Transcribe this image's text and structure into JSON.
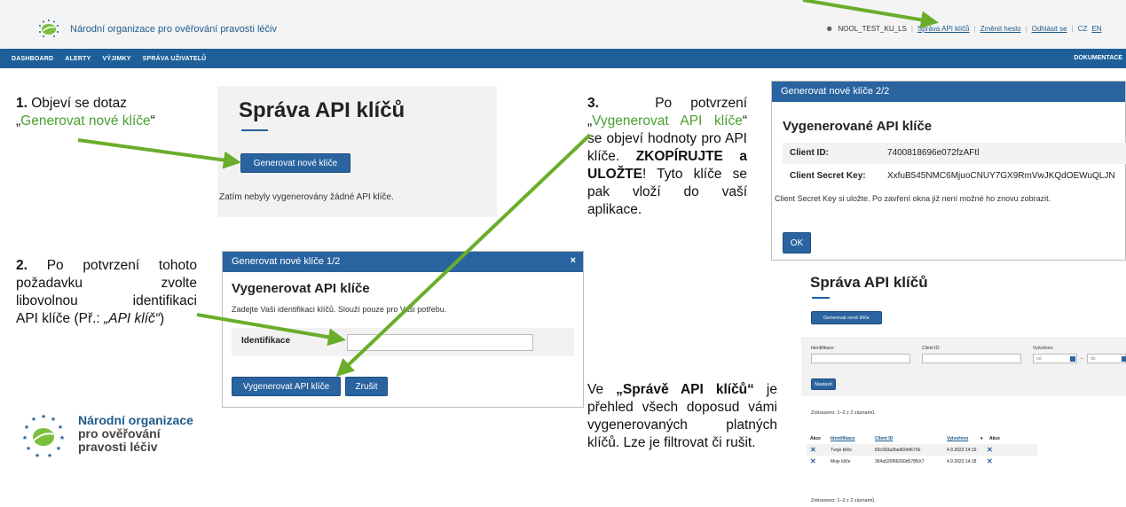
{
  "header": {
    "org_name": "Národní organizace pro ověřování pravosti léčiv",
    "user": "NOOL_TEST_KU_LS",
    "links": [
      "Správa API klíčů",
      "Změnit heslo",
      "Odhlásit se"
    ],
    "lang_cz": "CZ",
    "lang_en": "EN"
  },
  "nav": {
    "items": [
      "DASHBOARD",
      "ALERTY",
      "VÝJIMKY",
      "SPRÁVA UŽIVATELŮ"
    ],
    "right": "DOKUMENTACE"
  },
  "step1": {
    "num": "1.",
    "text_a": "Objeví se dotaz",
    "quote_open": "„",
    "green": "Generovat nové klíče",
    "quote_close": "“"
  },
  "step2": {
    "num": "2.",
    "line1": "Po potvrzení tohoto",
    "line2": "požadavku zvolte",
    "line3": "libovolnou identifikaci",
    "line4a": "API klíče (Př.: ",
    "line4b": "„API klíč“",
    "line4c": ")"
  },
  "step3": {
    "num": "3.",
    "line1": "Po potvrzení",
    "quote_open": "„",
    "green": "Vygenerovat API klíče",
    "quote_close": "“",
    "rest1": "se objeví hodnoty pro API klíče.",
    "bold": "ZKOPÍRUJTE a ULOŽTE",
    "rest2": "! Tyto klíče se pak vloží do vaší aplikace."
  },
  "step4": {
    "prefix": "Ve ",
    "bold": "„Správě API klíčů“",
    "rest": " je přehled všech doposud vámi vygenerovaných platných klíčů. Lze je filtrovat či rušit."
  },
  "panel1": {
    "title": "Správa API klíčů",
    "button": "Generovat nové klíče",
    "empty": "Zatím nebyly vygenerovány žádné API klíče."
  },
  "dialog1": {
    "header": "Generovat nové klíče 1/2",
    "close": "×",
    "title": "Vygenerovat API klíče",
    "subtitle": "Zadejte Vaši identifikaci klíčů. Slouží pouze pro Vaši potřebu.",
    "label": "Identifikace",
    "input_value": "",
    "btn_generate": "Vygenerovat API klíče",
    "btn_cancel": "Zrušit"
  },
  "dialog2": {
    "header": "Generovat nové klíče 2/2",
    "title": "Vygenerované API klíče",
    "client_id_label": "Client ID:",
    "client_id": "7400818696e072fzAFtl",
    "secret_label": "Client Secret Key:",
    "secret": "XxfuB545NMC6MjuoCNUY7GX9RmVwJKQdOEWuQLJN",
    "note": "Client Secret Key si uložte. Po zavření okna již není možné ho znovu zobrazit.",
    "ok": "OK"
  },
  "overview": {
    "title": "Správa API klíčů",
    "button": "Generovat nové klíče",
    "filter_labels": [
      "Identifikace:",
      "Client ID:",
      "Vytvořeno:"
    ],
    "date_from": "od",
    "date_sep": "–",
    "date_to": "do",
    "set_button": "Nastavit",
    "count": "Zobrazeno: 1–2 z 2 záznamů.",
    "count_bottom": "Zobrazeno: 1–2 z 2 záznamů.",
    "columns": [
      "Akce",
      "Identifikace",
      "Client ID",
      "Vytvořeno",
      "▾",
      "Akce"
    ],
    "rows": [
      {
        "ident": "Tvoje klíče",
        "client": "83c993a3bedf2d467Xk",
        "created": "4.9.2023 14:19"
      },
      {
        "ident": "Moje klíče",
        "client": "364a520f66260d578NX7",
        "created": "4.9.2023 14:18"
      }
    ]
  },
  "logo": {
    "line1": "Národní organizace",
    "line2": "pro ověřování",
    "line3": "pravosti léčiv"
  },
  "colors": {
    "brand_blue": "#1e5f99",
    "arrow_green": "#6aad2a",
    "text_green": "#4a9e2e"
  }
}
